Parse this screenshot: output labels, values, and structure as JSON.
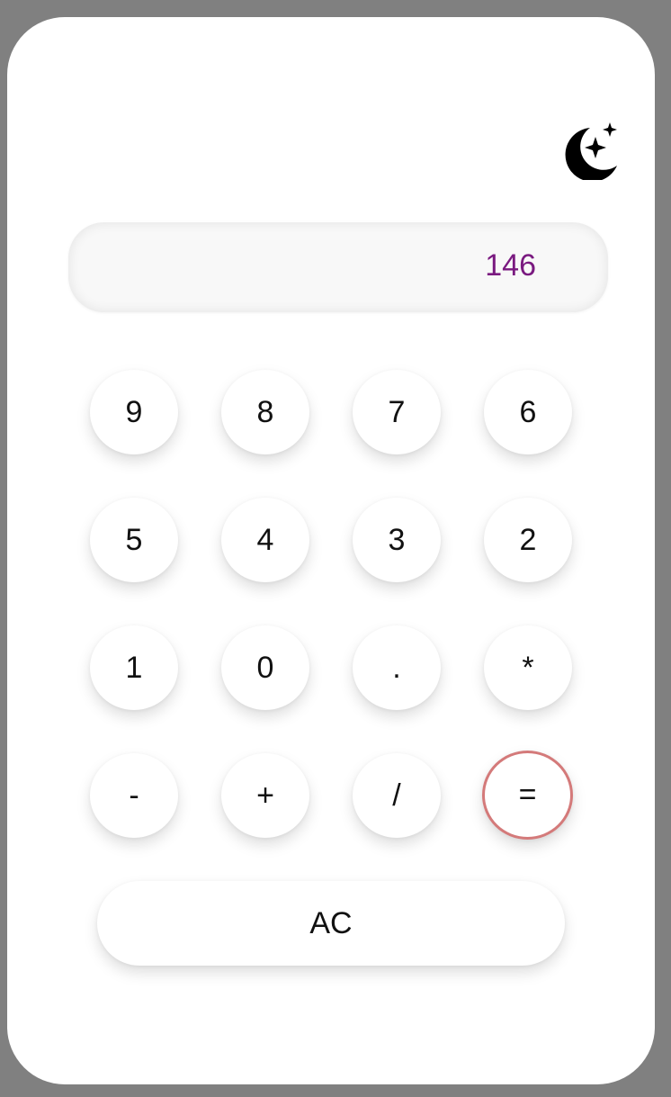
{
  "display": {
    "value": "146"
  },
  "theme_toggle": {
    "icon": "moon-stars-icon"
  },
  "keypad": {
    "rows": [
      [
        "9",
        "8",
        "7",
        "6"
      ],
      [
        "5",
        "4",
        "3",
        "2"
      ],
      [
        "1",
        "0",
        ".",
        "*"
      ],
      [
        "-",
        "+",
        "/",
        "="
      ]
    ],
    "clear_label": "AC"
  },
  "colors": {
    "display_text": "#7a1a80",
    "equals_border": "#d47a7a",
    "backdrop": "#808080"
  }
}
